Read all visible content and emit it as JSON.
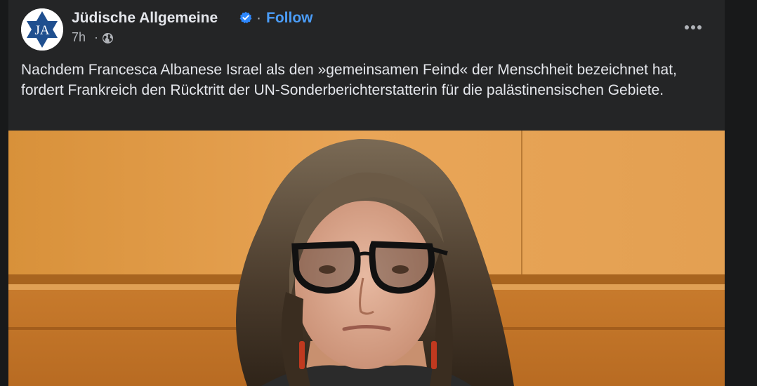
{
  "post": {
    "page_name": "Jüdische Allgemeine",
    "separator": "·",
    "follow_label": "Follow",
    "timestamp": "7h",
    "meta_separator": "·",
    "audience_icon": "globe-icon",
    "verified_icon": "verified-badge-icon",
    "more_icon": "more-options-icon",
    "avatar_text": "JA",
    "caption": "Nachdem Francesca Albanese Israel als den »gemeinsamen Feind« der Menschheit bezeichnet hat, fordert Frankreich den Rücktritt der UN-Sonderberichterstatterin für die palästinensischen Gebiete.",
    "photo_description_icon": "post-photo"
  },
  "colors": {
    "background": "#18191a",
    "card": "#242526",
    "primary_text": "#e4e6eb",
    "secondary_text": "#b0b3b8",
    "link_blue": "#4b9df8",
    "verified_blue": "#2d88ff",
    "avatar_blue": "#1f4f8f"
  }
}
